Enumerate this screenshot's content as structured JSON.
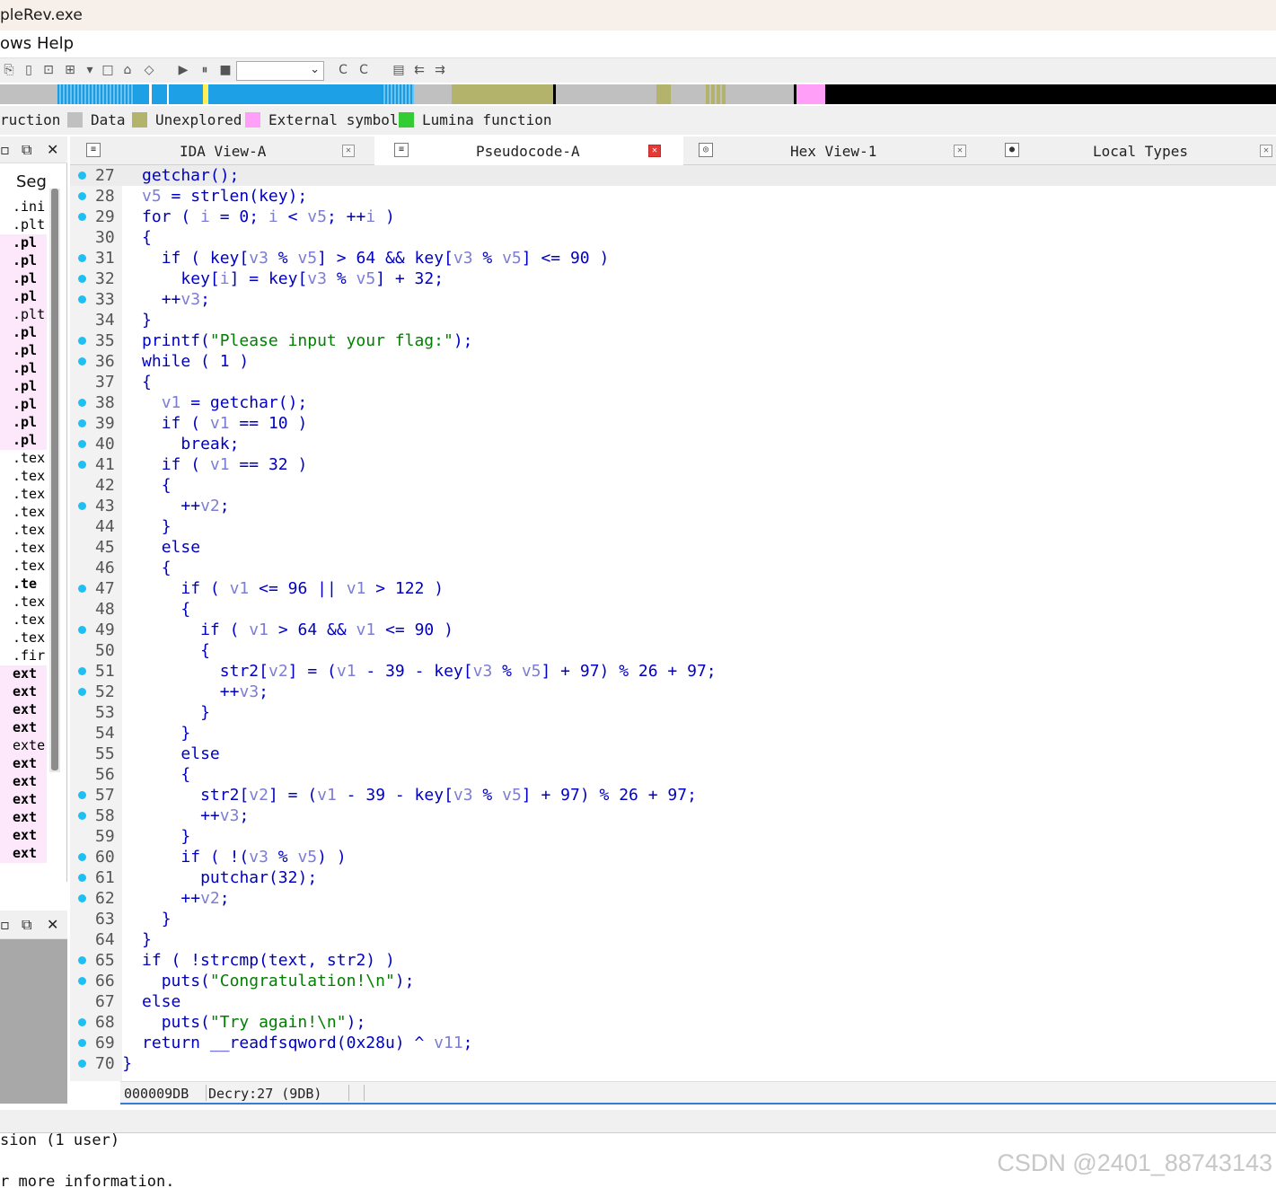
{
  "window": {
    "title": "pleRev.exe"
  },
  "menu": {
    "items": [
      "ows",
      "Help"
    ]
  },
  "toolbar": {
    "combo_value": ""
  },
  "legend": {
    "items": [
      {
        "label": "ruction",
        "color": ""
      },
      {
        "label": "Data",
        "color": "#c0c0c0"
      },
      {
        "label": "Unexplored",
        "color": "#b3b36b"
      },
      {
        "label": "External symbol",
        "color": "#ff9ff8"
      },
      {
        "label": "Lumina function",
        "color": "#33cc33"
      }
    ]
  },
  "segments_panel": {
    "title": "Seg",
    "rows": [
      ".ini",
      ".plt",
      ".pl",
      ".pl",
      ".pl",
      ".pl",
      ".plt",
      ".pl",
      ".pl",
      ".pl",
      ".pl",
      ".pl",
      ".pl",
      ".pl",
      ".tex",
      ".tex",
      ".tex",
      ".tex",
      ".tex",
      ".tex",
      ".tex",
      ".te",
      ".tex",
      ".tex",
      ".tex",
      ".fir",
      "ext",
      "ext",
      "ext",
      "ext",
      "exte",
      "ext",
      "ext",
      "ext",
      "ext",
      "ext",
      "ext"
    ]
  },
  "tabs": [
    {
      "label": "IDA View-A",
      "icon": "ida-view-icon",
      "active": false
    },
    {
      "label": "Pseudocode-A",
      "icon": "pseudocode-icon",
      "active": true
    },
    {
      "label": "Hex View-1",
      "icon": "hex-view-icon",
      "active": false
    },
    {
      "label": "Local Types",
      "icon": "local-types-icon",
      "active": false
    }
  ],
  "code": {
    "lines": [
      {
        "no": "27",
        "dot": true,
        "indent": 0,
        "tokens": [
          [
            "fn",
            "getchar"
          ],
          [
            "op",
            "();"
          ]
        ]
      },
      {
        "no": "28",
        "dot": true,
        "indent": 0,
        "tokens": [
          [
            "var",
            "v5"
          ],
          [
            "op",
            " = "
          ],
          [
            "fn",
            "strlen"
          ],
          [
            "op",
            "(key);"
          ]
        ]
      },
      {
        "no": "29",
        "dot": true,
        "indent": 0,
        "tokens": [
          [
            "kw",
            "for"
          ],
          [
            "op",
            " ( "
          ],
          [
            "var",
            "i"
          ],
          [
            "op",
            " = "
          ],
          [
            "num",
            "0"
          ],
          [
            "op",
            "; "
          ],
          [
            "var",
            "i"
          ],
          [
            "op",
            " < "
          ],
          [
            "var",
            "v5"
          ],
          [
            "op",
            "; ++"
          ],
          [
            "var",
            "i"
          ],
          [
            "op",
            " )"
          ]
        ]
      },
      {
        "no": "30",
        "dot": false,
        "indent": 0,
        "tokens": [
          [
            "op",
            "{"
          ]
        ]
      },
      {
        "no": "31",
        "dot": true,
        "indent": 1,
        "tokens": [
          [
            "kw",
            "if"
          ],
          [
            "op",
            " ( key["
          ],
          [
            "var",
            "v3"
          ],
          [
            "op",
            " % "
          ],
          [
            "var",
            "v5"
          ],
          [
            "op",
            "] > "
          ],
          [
            "num",
            "64"
          ],
          [
            "op",
            " && key["
          ],
          [
            "var",
            "v3"
          ],
          [
            "op",
            " % "
          ],
          [
            "var",
            "v5"
          ],
          [
            "op",
            "] <= "
          ],
          [
            "num",
            "90"
          ],
          [
            "op",
            " )"
          ]
        ]
      },
      {
        "no": "32",
        "dot": true,
        "indent": 2,
        "tokens": [
          [
            "op",
            "key["
          ],
          [
            "var",
            "i"
          ],
          [
            "op",
            "] = key["
          ],
          [
            "var",
            "v3"
          ],
          [
            "op",
            " % "
          ],
          [
            "var",
            "v5"
          ],
          [
            "op",
            "] + "
          ],
          [
            "num",
            "32"
          ],
          [
            "op",
            ";"
          ]
        ]
      },
      {
        "no": "33",
        "dot": true,
        "indent": 1,
        "tokens": [
          [
            "op",
            "++"
          ],
          [
            "var",
            "v3"
          ],
          [
            "op",
            ";"
          ]
        ]
      },
      {
        "no": "34",
        "dot": false,
        "indent": 0,
        "tokens": [
          [
            "op",
            "}"
          ]
        ]
      },
      {
        "no": "35",
        "dot": true,
        "indent": 0,
        "tokens": [
          [
            "fn",
            "printf"
          ],
          [
            "op",
            "("
          ],
          [
            "str",
            "\"Please input your flag:\""
          ],
          [
            "op",
            ");"
          ]
        ]
      },
      {
        "no": "36",
        "dot": true,
        "indent": 0,
        "tokens": [
          [
            "kw",
            "while"
          ],
          [
            "op",
            " ( "
          ],
          [
            "num",
            "1"
          ],
          [
            "op",
            " )"
          ]
        ]
      },
      {
        "no": "37",
        "dot": false,
        "indent": 0,
        "tokens": [
          [
            "op",
            "{"
          ]
        ]
      },
      {
        "no": "38",
        "dot": true,
        "indent": 1,
        "tokens": [
          [
            "var",
            "v1"
          ],
          [
            "op",
            " = "
          ],
          [
            "fn",
            "getchar"
          ],
          [
            "op",
            "();"
          ]
        ]
      },
      {
        "no": "39",
        "dot": true,
        "indent": 1,
        "tokens": [
          [
            "kw",
            "if"
          ],
          [
            "op",
            " ( "
          ],
          [
            "var",
            "v1"
          ],
          [
            "op",
            " == "
          ],
          [
            "num",
            "10"
          ],
          [
            "op",
            " )"
          ]
        ]
      },
      {
        "no": "40",
        "dot": true,
        "indent": 2,
        "tokens": [
          [
            "kw",
            "break"
          ],
          [
            "op",
            ";"
          ]
        ]
      },
      {
        "no": "41",
        "dot": true,
        "indent": 1,
        "tokens": [
          [
            "kw",
            "if"
          ],
          [
            "op",
            " ( "
          ],
          [
            "var",
            "v1"
          ],
          [
            "op",
            " == "
          ],
          [
            "num",
            "32"
          ],
          [
            "op",
            " )"
          ]
        ]
      },
      {
        "no": "42",
        "dot": false,
        "indent": 1,
        "tokens": [
          [
            "op",
            "{"
          ]
        ]
      },
      {
        "no": "43",
        "dot": true,
        "indent": 2,
        "tokens": [
          [
            "op",
            "++"
          ],
          [
            "var",
            "v2"
          ],
          [
            "op",
            ";"
          ]
        ]
      },
      {
        "no": "44",
        "dot": false,
        "indent": 1,
        "tokens": [
          [
            "op",
            "}"
          ]
        ]
      },
      {
        "no": "45",
        "dot": false,
        "indent": 1,
        "tokens": [
          [
            "kw",
            "else"
          ]
        ]
      },
      {
        "no": "46",
        "dot": false,
        "indent": 1,
        "tokens": [
          [
            "op",
            "{"
          ]
        ]
      },
      {
        "no": "47",
        "dot": true,
        "indent": 2,
        "tokens": [
          [
            "kw",
            "if"
          ],
          [
            "op",
            " ( "
          ],
          [
            "var",
            "v1"
          ],
          [
            "op",
            " <= "
          ],
          [
            "num",
            "96"
          ],
          [
            "op",
            " || "
          ],
          [
            "var",
            "v1"
          ],
          [
            "op",
            " > "
          ],
          [
            "num",
            "122"
          ],
          [
            "op",
            " )"
          ]
        ]
      },
      {
        "no": "48",
        "dot": false,
        "indent": 2,
        "tokens": [
          [
            "op",
            "{"
          ]
        ]
      },
      {
        "no": "49",
        "dot": true,
        "indent": 3,
        "tokens": [
          [
            "kw",
            "if"
          ],
          [
            "op",
            " ( "
          ],
          [
            "var",
            "v1"
          ],
          [
            "op",
            " > "
          ],
          [
            "num",
            "64"
          ],
          [
            "op",
            " && "
          ],
          [
            "var",
            "v1"
          ],
          [
            "op",
            " <= "
          ],
          [
            "num",
            "90"
          ],
          [
            "op",
            " )"
          ]
        ]
      },
      {
        "no": "50",
        "dot": false,
        "indent": 3,
        "tokens": [
          [
            "op",
            "{"
          ]
        ]
      },
      {
        "no": "51",
        "dot": true,
        "indent": 4,
        "tokens": [
          [
            "op",
            "str2["
          ],
          [
            "var",
            "v2"
          ],
          [
            "op",
            "] = ("
          ],
          [
            "var",
            "v1"
          ],
          [
            "op",
            " - "
          ],
          [
            "num",
            "39"
          ],
          [
            "op",
            " - key["
          ],
          [
            "var",
            "v3"
          ],
          [
            "op",
            " % "
          ],
          [
            "var",
            "v5"
          ],
          [
            "op",
            "] + "
          ],
          [
            "num",
            "97"
          ],
          [
            "op",
            ") % "
          ],
          [
            "num",
            "26"
          ],
          [
            "op",
            " + "
          ],
          [
            "num",
            "97"
          ],
          [
            "op",
            ";"
          ]
        ]
      },
      {
        "no": "52",
        "dot": true,
        "indent": 4,
        "tokens": [
          [
            "op",
            "++"
          ],
          [
            "var",
            "v3"
          ],
          [
            "op",
            ";"
          ]
        ]
      },
      {
        "no": "53",
        "dot": false,
        "indent": 3,
        "tokens": [
          [
            "op",
            "}"
          ]
        ]
      },
      {
        "no": "54",
        "dot": false,
        "indent": 2,
        "tokens": [
          [
            "op",
            "}"
          ]
        ]
      },
      {
        "no": "55",
        "dot": false,
        "indent": 2,
        "tokens": [
          [
            "kw",
            "else"
          ]
        ]
      },
      {
        "no": "56",
        "dot": false,
        "indent": 2,
        "tokens": [
          [
            "op",
            "{"
          ]
        ]
      },
      {
        "no": "57",
        "dot": true,
        "indent": 3,
        "tokens": [
          [
            "op",
            "str2["
          ],
          [
            "var",
            "v2"
          ],
          [
            "op",
            "] = ("
          ],
          [
            "var",
            "v1"
          ],
          [
            "op",
            " - "
          ],
          [
            "num",
            "39"
          ],
          [
            "op",
            " - key["
          ],
          [
            "var",
            "v3"
          ],
          [
            "op",
            " % "
          ],
          [
            "var",
            "v5"
          ],
          [
            "op",
            "] + "
          ],
          [
            "num",
            "97"
          ],
          [
            "op",
            ") % "
          ],
          [
            "num",
            "26"
          ],
          [
            "op",
            " + "
          ],
          [
            "num",
            "97"
          ],
          [
            "op",
            ";"
          ]
        ]
      },
      {
        "no": "58",
        "dot": true,
        "indent": 3,
        "tokens": [
          [
            "op",
            "++"
          ],
          [
            "var",
            "v3"
          ],
          [
            "op",
            ";"
          ]
        ]
      },
      {
        "no": "59",
        "dot": false,
        "indent": 2,
        "tokens": [
          [
            "op",
            "}"
          ]
        ]
      },
      {
        "no": "60",
        "dot": true,
        "indent": 2,
        "tokens": [
          [
            "kw",
            "if"
          ],
          [
            "op",
            " ( !("
          ],
          [
            "var",
            "v3"
          ],
          [
            "op",
            " % "
          ],
          [
            "var",
            "v5"
          ],
          [
            "op",
            ") )"
          ]
        ]
      },
      {
        "no": "61",
        "dot": true,
        "indent": 3,
        "tokens": [
          [
            "fn",
            "putchar"
          ],
          [
            "op",
            "("
          ],
          [
            "num",
            "32"
          ],
          [
            "op",
            ");"
          ]
        ]
      },
      {
        "no": "62",
        "dot": true,
        "indent": 2,
        "tokens": [
          [
            "op",
            "++"
          ],
          [
            "var",
            "v2"
          ],
          [
            "op",
            ";"
          ]
        ]
      },
      {
        "no": "63",
        "dot": false,
        "indent": 1,
        "tokens": [
          [
            "op",
            "}"
          ]
        ]
      },
      {
        "no": "64",
        "dot": false,
        "indent": 0,
        "tokens": [
          [
            "op",
            "}"
          ]
        ]
      },
      {
        "no": "65",
        "dot": true,
        "indent": 0,
        "tokens": [
          [
            "kw",
            "if"
          ],
          [
            "op",
            " ( !"
          ],
          [
            "fn",
            "strcmp"
          ],
          [
            "op",
            "(text, str2) )"
          ]
        ]
      },
      {
        "no": "66",
        "dot": true,
        "indent": 1,
        "tokens": [
          [
            "fn",
            "puts"
          ],
          [
            "op",
            "("
          ],
          [
            "str",
            "\"Congratulation!\\n\""
          ],
          [
            "op",
            ");"
          ]
        ]
      },
      {
        "no": "67",
        "dot": false,
        "indent": 0,
        "tokens": [
          [
            "kw",
            "else"
          ]
        ]
      },
      {
        "no": "68",
        "dot": true,
        "indent": 1,
        "tokens": [
          [
            "fn",
            "puts"
          ],
          [
            "op",
            "("
          ],
          [
            "str",
            "\"Try again!\\n\""
          ],
          [
            "op",
            ");"
          ]
        ]
      },
      {
        "no": "69",
        "dot": true,
        "indent": 0,
        "tokens": [
          [
            "kw",
            "return"
          ],
          [
            "op",
            " "
          ],
          [
            "fn",
            "__readfsqword"
          ],
          [
            "op",
            "("
          ],
          [
            "num",
            "0x28u"
          ],
          [
            "op",
            ") ^ "
          ],
          [
            "var",
            "v11"
          ],
          [
            "op",
            ";"
          ]
        ]
      },
      {
        "no": "70",
        "dot": true,
        "indent": -1,
        "tokens": [
          [
            "op",
            "}"
          ]
        ]
      }
    ]
  },
  "status": {
    "address": "000009DB",
    "location": "Decry:27 (9DB)"
  },
  "output": {
    "line1": "sion (1 user)",
    "line2": "r more information."
  },
  "watermark": "CSDN @2401_88743143"
}
